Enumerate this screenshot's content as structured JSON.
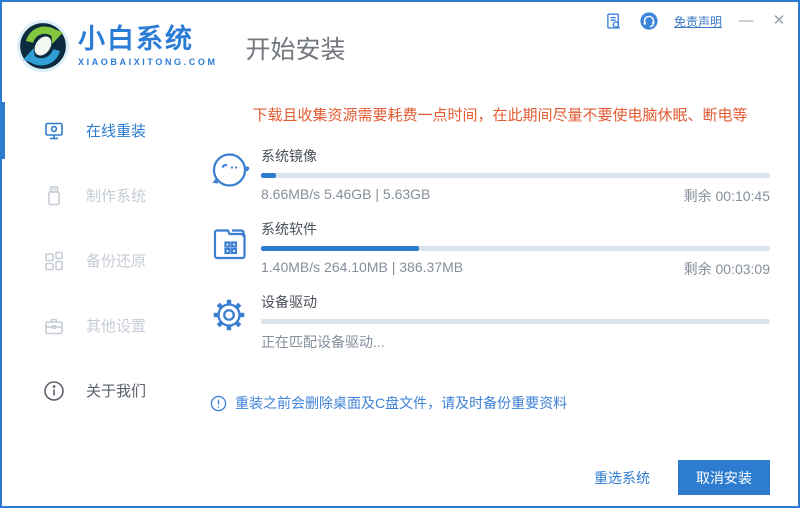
{
  "header": {
    "brand_name": "小白系统",
    "brand_domain": "XIAOBAIXITONG.COM",
    "page_title": "开始安装",
    "disclaimer_link": "免责声明",
    "minimize_glyph": "—",
    "close_glyph": "✕",
    "icons": [
      "document-search-icon",
      "support-headset-icon"
    ]
  },
  "sidebar": {
    "items": [
      {
        "label": "在线重装",
        "icon": "monitor-icon",
        "state": "active"
      },
      {
        "label": "制作系统",
        "icon": "usb-icon",
        "state": "disabled"
      },
      {
        "label": "备份还原",
        "icon": "blocks-icon",
        "state": "disabled"
      },
      {
        "label": "其他设置",
        "icon": "toolbox-icon",
        "state": "disabled"
      },
      {
        "label": "关于我们",
        "icon": "info-icon",
        "state": "normal"
      }
    ]
  },
  "main": {
    "warning": "下载且收集资源需要耗费一点时间，在此期间尽量不要使电脑休眠、断电等",
    "tasks": [
      {
        "title": "系统镜像",
        "icon": "mascot-face-icon",
        "progress_percent": 3,
        "stats": "8.66MB/s 5.46GB | 5.63GB",
        "remaining": "剩余 00:10:45"
      },
      {
        "title": "系统软件",
        "icon": "folder-apps-icon",
        "progress_percent": 31,
        "stats": "1.40MB/s 264.10MB | 386.37MB",
        "remaining": "剩余 00:03:09"
      },
      {
        "title": "设备驱动",
        "icon": "gear-icon",
        "progress_percent": 0,
        "stats": "正在匹配设备驱动...",
        "remaining": ""
      }
    ],
    "note": "重装之前会删除桌面及C盘文件，请及时备份重要资料"
  },
  "footer": {
    "reselect_label": "重选系统",
    "cancel_label": "取消安装"
  },
  "colors": {
    "accent": "#2e7cd0",
    "warning_text": "#e25b32",
    "note_text": "#3e82d8",
    "progress_track": "#dbe4ee",
    "disabled_text": "#c6ccd5"
  }
}
